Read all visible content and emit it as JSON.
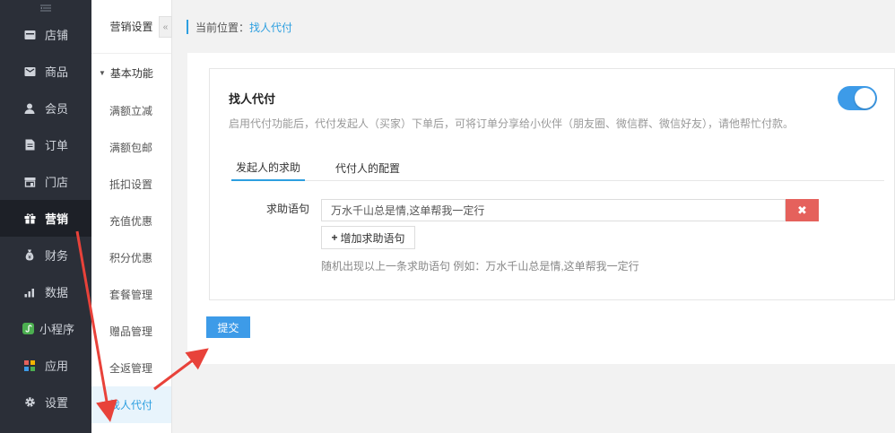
{
  "sidebar": {
    "collapse_icon": "menu-collapse-icon",
    "items": [
      {
        "label": "店铺",
        "icon": "store-icon"
      },
      {
        "label": "商品",
        "icon": "goods-icon"
      },
      {
        "label": "会员",
        "icon": "member-icon"
      },
      {
        "label": "订单",
        "icon": "order-icon"
      },
      {
        "label": "门店",
        "icon": "shop-icon"
      },
      {
        "label": "营销",
        "icon": "gift-icon",
        "active": true
      },
      {
        "label": "财务",
        "icon": "money-bag-icon"
      },
      {
        "label": "数据",
        "icon": "bar-chart-icon"
      },
      {
        "label": "小程序",
        "icon": "mini-program-icon"
      },
      {
        "label": "应用",
        "icon": "apps-icon"
      },
      {
        "label": "设置",
        "icon": "gear-icon"
      }
    ]
  },
  "submenu": {
    "title": "营销设置",
    "group": "基本功能",
    "items": [
      {
        "label": "满额立减"
      },
      {
        "label": "满额包邮"
      },
      {
        "label": "抵扣设置"
      },
      {
        "label": "充值优惠"
      },
      {
        "label": "积分优惠"
      },
      {
        "label": "套餐管理"
      },
      {
        "label": "赠品管理"
      },
      {
        "label": "全返管理"
      },
      {
        "label": "找人代付",
        "active": true
      }
    ]
  },
  "breadcrumb": {
    "prefix": "当前位置：",
    "current": "找人代付"
  },
  "card": {
    "title": "找人代付",
    "description": "启用代付功能后，代付发起人（买家）下单后，可将订单分享给小伙伴（朋友圈、微信群、微信好友），请他帮忙付款。",
    "toggle_on": true
  },
  "tabs": [
    {
      "label": "发起人的求助",
      "active": true
    },
    {
      "label": "代付人的配置"
    }
  ],
  "form": {
    "phrase_label": "求助语句",
    "phrase_value": "万水千山总是情,这单帮我一定行",
    "delete_icon": "close-icon",
    "add_label": "增加求助语句",
    "hint": "随机出现以上一条求助语句 例如：万水千山总是情,这单帮我一定行"
  },
  "submit_label": "提交",
  "colors": {
    "accent": "#2d9fe0",
    "sidebar_bg": "#2b2f38",
    "danger": "#e5615c",
    "annotation_arrow": "#e8423a"
  }
}
